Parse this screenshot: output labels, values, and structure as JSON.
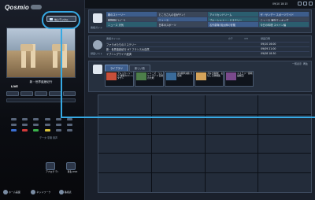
{
  "app": {
    "logo": "Qosmio",
    "tuner_button_label": "地上デジタル"
  },
  "sidebar": {
    "preview_caption": "新・世界遺産紀行",
    "live_label": "LIVE",
    "remote_labels": [
      "データ",
      "字幕",
      "音声"
    ],
    "bottom_icons": [
      "アナログ テレビ",
      "再生 DVD"
    ],
    "bottom_nav": [
      {
        "label": "ホーム画面",
        "icon": "home-icon"
      },
      {
        "label": "ネットワーク",
        "icon": "network-icon"
      },
      {
        "label": "番組表",
        "icon": "guide-icon"
      }
    ]
  },
  "top_status": {
    "datetime": "09/10 18:15"
  },
  "epg": {
    "section_label": "番組ガイド",
    "rows": [
      [
        {
          "text": "朝のストーリー",
          "tone": "blue"
        },
        {
          "text": "ところさんの目がテン！",
          "tone": "grey"
        },
        {
          "text": "アメリカンドリーム",
          "tone": "teal"
        },
        {
          "text": "ザ・サンデー スポーツワイド",
          "tone": "blue"
        }
      ],
      [
        {
          "text": "動物園にいこう",
          "tone": "grey"
        },
        {
          "text": "ニュース",
          "tone": "blue"
        },
        {
          "text": "ブルーシャトー・ミステリー",
          "tone": "teal"
        },
        {
          "text": "ニュース 海外クッキング",
          "tone": "grey"
        }
      ],
      [
        {
          "text": "ニュース 天気",
          "tone": "teal"
        },
        {
          "text": "日本のスポーツ",
          "tone": "grey"
        },
        {
          "text": "名作劇場 桃太郎の冒険",
          "tone": "blue"
        },
        {
          "text": "今日の料理 スペイン編",
          "tone": "teal"
        }
      ]
    ]
  },
  "recorded": {
    "section_label": "録画リスト",
    "headers": [
      "番組タイトル",
      "カテ",
      "CH",
      "録画日時"
    ],
    "items": [
      [
        "ファラオたちのミステリー",
        "",
        "",
        "09/10 16:00"
      ],
      [
        "新・世界遺産紀行 #7 フランス大自然",
        "",
        "",
        "09/09 21:00"
      ],
      [
        "イブニングワイド経済",
        "",
        "",
        "09/08 18:30"
      ]
    ]
  },
  "thumbs": {
    "tabs": [
      "ライブラリ",
      "新しい順"
    ],
    "active_tab": 0,
    "tools": [
      "一覧表示",
      "再生"
    ],
    "items": [
      {
        "caption": "アメリカンリーグ 優勝カウントダウン",
        "date": "09/10",
        "color": "#c84f3a"
      },
      {
        "caption": "シリーズ・ワイルドライフ 自然の大地",
        "date": "09/09",
        "color": "#4d7e4a"
      },
      {
        "caption": "第5戦準決勝 大接戦",
        "date": "09/08",
        "color": "#3a6b9a"
      },
      {
        "caption": "大好き動物！ おもしろ映像集",
        "date": "09/07",
        "color": "#d4a35a"
      },
      {
        "caption": "ミステリー劇場 最終回",
        "date": "09/06",
        "color": "#7a4a8c"
      }
    ]
  }
}
